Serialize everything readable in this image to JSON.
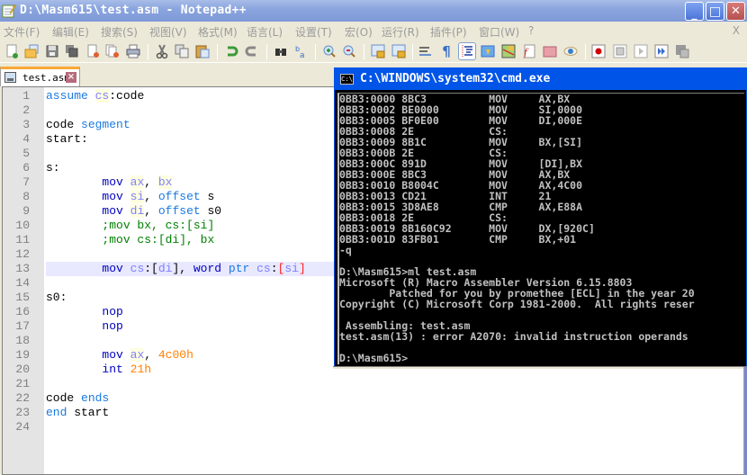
{
  "window": {
    "title": "D:\\Masm615\\test.asm - Notepad++",
    "controls": {
      "minimize": "_",
      "maximize": "□",
      "close": "✕"
    }
  },
  "menu": {
    "items": [
      "文件(F)",
      "编辑(E)",
      "搜索(S)",
      "视图(V)",
      "格式(M)",
      "语言(L)",
      "设置(T)",
      "宏(O)",
      "运行(R)",
      "插件(P)",
      "窗口(W)",
      "?"
    ],
    "close_doc": "X"
  },
  "toolbar": {
    "icons": [
      "new-file",
      "open-file",
      "save",
      "save-all",
      "close",
      "close-all",
      "print",
      "cut",
      "copy",
      "paste",
      "undo",
      "redo",
      "find",
      "replace",
      "zoom-in",
      "zoom-out",
      "sync-vertical",
      "sync-horizontal",
      "word-wrap",
      "show-all-chars",
      "indent-guide",
      "user-defined-language",
      "document-map",
      "function-list",
      "folder-as-workspace",
      "monitoring",
      "macro-record",
      "macro-stop",
      "macro-play",
      "macro-run-multiple",
      "macro-save"
    ]
  },
  "tabs": [
    {
      "label": "test.asm",
      "active": true
    }
  ],
  "editor": {
    "current_line": 13,
    "lines": [
      {
        "n": "1",
        "segments": [
          [
            "kw",
            "assume"
          ],
          [
            "t",
            " "
          ],
          [
            "reg",
            "cs"
          ],
          [
            "t",
            ":code"
          ]
        ]
      },
      {
        "n": "2",
        "segments": []
      },
      {
        "n": "3",
        "segments": [
          [
            "t",
            "code "
          ],
          [
            "kw",
            "segment"
          ]
        ]
      },
      {
        "n": "4",
        "segments": [
          [
            "t",
            "start:"
          ]
        ]
      },
      {
        "n": "5",
        "segments": []
      },
      {
        "n": "6",
        "segments": [
          [
            "t",
            "s:"
          ]
        ]
      },
      {
        "n": "7",
        "segments": [
          [
            "t",
            "        "
          ],
          [
            "ins",
            "mov"
          ],
          [
            "t",
            " "
          ],
          [
            "reg",
            "ax"
          ],
          [
            "t",
            ", "
          ],
          [
            "reg",
            "bx"
          ]
        ]
      },
      {
        "n": "8",
        "segments": [
          [
            "t",
            "        "
          ],
          [
            "ins",
            "mov"
          ],
          [
            "t",
            " "
          ],
          [
            "reg",
            "si"
          ],
          [
            "t",
            ", "
          ],
          [
            "kw",
            "offset"
          ],
          [
            "t",
            " s"
          ]
        ]
      },
      {
        "n": "9",
        "segments": [
          [
            "t",
            "        "
          ],
          [
            "ins",
            "mov"
          ],
          [
            "t",
            " "
          ],
          [
            "reg",
            "di"
          ],
          [
            "t",
            ", "
          ],
          [
            "kw",
            "offset"
          ],
          [
            "t",
            " s0"
          ]
        ]
      },
      {
        "n": "10",
        "segments": [
          [
            "t",
            "        "
          ],
          [
            "cmt",
            ";mov bx, cs:[si]"
          ]
        ]
      },
      {
        "n": "11",
        "segments": [
          [
            "t",
            "        "
          ],
          [
            "cmt",
            ";mov cs:[di], bx"
          ]
        ]
      },
      {
        "n": "12",
        "segments": []
      },
      {
        "n": "13",
        "segments": [
          [
            "t",
            "        "
          ],
          [
            "ins",
            "mov"
          ],
          [
            "t",
            " "
          ],
          [
            "kwl",
            "cs"
          ],
          [
            "t",
            ":["
          ],
          [
            "kwl",
            "di"
          ],
          [
            "t",
            "], "
          ],
          [
            "ins",
            "word"
          ],
          [
            "t",
            " "
          ],
          [
            "kw",
            "ptr"
          ],
          [
            "t",
            " "
          ],
          [
            "kwl",
            "cs"
          ],
          [
            "t",
            ":"
          ],
          [
            "br",
            "["
          ],
          [
            "kwl",
            "si"
          ],
          [
            "br",
            "]"
          ]
        ]
      },
      {
        "n": "14",
        "segments": []
      },
      {
        "n": "15",
        "segments": [
          [
            "t",
            "s0:"
          ]
        ]
      },
      {
        "n": "16",
        "segments": [
          [
            "t",
            "        "
          ],
          [
            "ins",
            "nop"
          ]
        ]
      },
      {
        "n": "17",
        "segments": [
          [
            "t",
            "        "
          ],
          [
            "ins",
            "nop"
          ]
        ]
      },
      {
        "n": "18",
        "segments": []
      },
      {
        "n": "19",
        "segments": [
          [
            "t",
            "        "
          ],
          [
            "ins",
            "mov"
          ],
          [
            "t",
            " "
          ],
          [
            "reg",
            "ax"
          ],
          [
            "t",
            ", "
          ],
          [
            "num",
            "4c00h"
          ]
        ]
      },
      {
        "n": "20",
        "segments": [
          [
            "t",
            "        "
          ],
          [
            "ins",
            "int"
          ],
          [
            "t",
            " "
          ],
          [
            "num",
            "21h"
          ]
        ]
      },
      {
        "n": "21",
        "segments": []
      },
      {
        "n": "22",
        "segments": [
          [
            "t",
            "code "
          ],
          [
            "kw",
            "ends"
          ]
        ]
      },
      {
        "n": "23",
        "segments": [
          [
            "kw",
            "end"
          ],
          [
            "t",
            " start"
          ]
        ]
      },
      {
        "n": "24",
        "segments": []
      }
    ]
  },
  "cmd": {
    "title": "C:\\WINDOWS\\system32\\cmd.exe",
    "icon_label": "C:\\",
    "lines": [
      "0BB3:0000 8BC3          MOV     AX,BX",
      "0BB3:0002 BE0000        MOV     SI,0000",
      "0BB3:0005 BF0E00        MOV     DI,000E",
      "0BB3:0008 2E            CS:",
      "0BB3:0009 8B1C          MOV     BX,[SI]",
      "0BB3:000B 2E            CS:",
      "0BB3:000C 891D          MOV     [DI],BX",
      "0BB3:000E 8BC3          MOV     AX,BX",
      "0BB3:0010 B8004C        MOV     AX,4C00",
      "0BB3:0013 CD21          INT     21",
      "0BB3:0015 3D8AE8        CMP     AX,E88A",
      "0BB3:0018 2E            CS:",
      "0BB3:0019 8B160C92      MOV     DX,[920C]",
      "0BB3:001D 83FB01        CMP     BX,+01",
      "-q",
      "",
      "D:\\Masm615>ml test.asm",
      "Microsoft (R) Macro Assembler Version 6.15.8803",
      "        Patched for you by promethee [ECL] in the year 20",
      "Copyright (C) Microsoft Corp 1981-2000.  All rights reser",
      "",
      " Assembling: test.asm",
      "test.asm(13) : error A2070: invalid instruction operands",
      "",
      "D:\\Masm615>"
    ]
  }
}
